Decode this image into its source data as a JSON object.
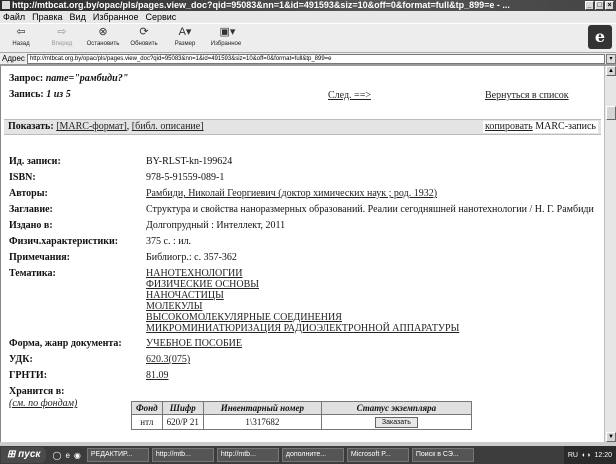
{
  "window": {
    "title": "http://mtbcat.org.by/opac/pls/pages.view_doc?qid=95083&nn=1&id=491593&siz=10&off=0&format=full&tp_899=e - ..."
  },
  "menu": [
    "Файл",
    "Правка",
    "Вид",
    "Избранное",
    "Сервис"
  ],
  "toolbar": {
    "back": "Назад",
    "forward": "Вперед",
    "stop": "Остановить",
    "refresh": "Обновить",
    "size": "Размер",
    "favorites": "Избранное"
  },
  "address": {
    "label": "Адрес",
    "url": "http://mtbcat.org.by/opac/pls/pages.view_doc?qid=95083&nn=1&id=491593&siz=10&off=0&format=full&tp_899=e"
  },
  "page": {
    "query_label": "Запрос:",
    "query_value": "name=\"рамбиди?\"",
    "record_label": "Запись:",
    "record_value": "1 из 5",
    "next_link": "След. ==>",
    "back_link": "Вернуться в список",
    "show_label": "Показать:",
    "marc_format": "[MARC-формат]",
    "bibl_desc": "[библ. описание]",
    "copy_link": "копировать",
    "copy_suffix": " MARC-запись",
    "fields": {
      "id_label": "Ид. записи:",
      "id_value": "BY-RLST-kn-199624",
      "isbn_label": "ISBN:",
      "isbn_value": "978-5-91559-089-1",
      "authors_label": "Авторы:",
      "authors_value": "Рамбиди, Николай Георгиевич (доктор химических наук ; род. 1932)",
      "title_label": "Заглавие:",
      "title_value": "Структура и свойства наноразмерных образований. Реалии сегодняшней нанотехнологии / Н. Г. Рамбиди",
      "published_label": "Издано в:",
      "published_value": "Долгопрудный : Интеллект, 2011",
      "physical_label": "Физич.характеристики:",
      "physical_value": "375 с. : ил.",
      "notes_label": "Примечания:",
      "notes_value": "Библиогр.: с. 357-362",
      "subjects_label": "Тематика:",
      "subjects": [
        "НАНОТЕХНОЛОГИИ",
        "ФИЗИЧЕСКИЕ ОСНОВЫ",
        "НАНОЧАСТИЦЫ",
        "МОЛЕКУЛЫ",
        "ВЫСОКОМОЛЕКУЛЯРНЫЕ СОЕДИНЕНИЯ",
        "МИКРОМИНИАТЮРИЗАЦИЯ РАДИОЭЛЕКТРОННОЙ АППАРАТУРЫ"
      ],
      "genre_label": "Форма, жанр документа:",
      "genre_value": "УЧЕБНОЕ ПОСОБИЕ",
      "udc_label": "УДК:",
      "udc_value": "620.3(075)",
      "grnti_label": "ГРНТИ:",
      "grnti_value": "81.09",
      "stored_label": "Хранится в:",
      "stored_link": "(см. по фондам)"
    },
    "holdings": {
      "headers": [
        "Фонд",
        "Шифр",
        "Инвентарный номер",
        "Статус экземпляра"
      ],
      "row": [
        "нтл",
        "620/Р 21",
        "1\\317682"
      ],
      "order_button": "Заказать"
    }
  },
  "taskbar": {
    "start": "пуск",
    "tasks": [
      "РЕДАКТИР...",
      "http://mtb...",
      "http://mtb...",
      "дополните...",
      "Microsoft P...",
      "Поиск в СЭ..."
    ],
    "lang": "RU",
    "time": "12:20"
  }
}
